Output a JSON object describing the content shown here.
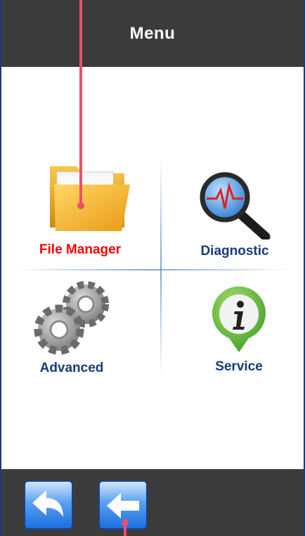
{
  "header": {
    "title": "Menu"
  },
  "menu": {
    "items": [
      {
        "label": "File Manager",
        "color": "#ff0000",
        "icon": "folder-icon"
      },
      {
        "label": "Diagnostic",
        "color": "#1a3c78",
        "icon": "magnifier-heartbeat-icon"
      },
      {
        "label": "Advanced",
        "color": "#1a3c78",
        "icon": "gears-icon"
      },
      {
        "label": "Service",
        "color": "#1a3c78",
        "icon": "info-pin-icon"
      }
    ]
  },
  "footer": {
    "buttons": [
      {
        "icon": "back-arrow-icon"
      },
      {
        "icon": "return-arrow-icon"
      }
    ]
  },
  "colors": {
    "header_bg": "#3b3b3b",
    "accent_selected": "#ff0000",
    "label_default": "#1a3c78",
    "annotation": "#e8506c"
  }
}
